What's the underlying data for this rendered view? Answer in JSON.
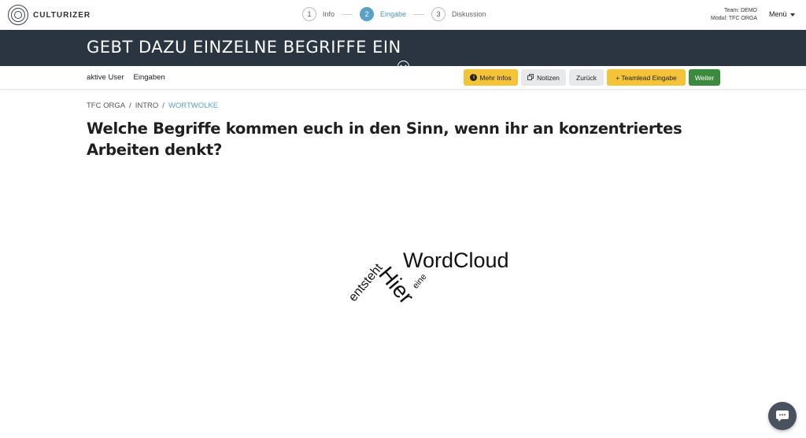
{
  "brand": {
    "name": "CULTURIZER"
  },
  "stepper": [
    {
      "number": "1",
      "label": "Info",
      "active": false
    },
    {
      "number": "2",
      "label": "Eingabe",
      "active": true
    },
    {
      "number": "3",
      "label": "Diskussion",
      "active": false
    }
  ],
  "team_info": {
    "team": "Team: DEMO",
    "modul": "Modul: TFC ORGA"
  },
  "menu": {
    "label": "Menü"
  },
  "banner": {
    "title": "GEBT DAZU EINZELNE BEGRIFFE EIN"
  },
  "toolbar": {
    "links": [
      "aktive User",
      "Eingaben"
    ],
    "more_info": "Mehr Infos",
    "notes": "Notizen",
    "back": "Zurück",
    "teamlead": "+ Teamlead Eingabe",
    "next": "Weiter"
  },
  "breadcrumb": [
    "TFC ORGA",
    "INTRO",
    "WORTWOLKE"
  ],
  "question": "Welche Begriffe kommen euch in den Sinn, wenn ihr an konzentriertes Arbeiten denkt?",
  "wordcloud": {
    "words": [
      "WordCloud",
      "entsteht",
      "eine",
      "Hier"
    ]
  },
  "colors": {
    "banner_bg": "#2b3441",
    "accent_blue": "#5aa1c8",
    "yellow": "#f4c338",
    "green": "#3c8a3e"
  }
}
